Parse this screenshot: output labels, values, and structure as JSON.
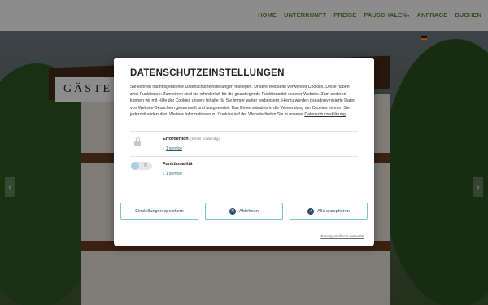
{
  "nav": {
    "items": [
      "HOME",
      "UNTERKUNFT",
      "PREISE",
      "PAUSCHALEN",
      "ANFRAGE",
      "BUCHEN"
    ],
    "dropdown_caret": "▾"
  },
  "hero": {
    "sign_text": "GÄSTE"
  },
  "modal": {
    "title": "DATENSCHUTZEINSTELLUNGEN",
    "description": "Sie können nachfolgend Ihre Datenschutzeinstellungen festlegen. Unsere Webseite verwendet Cookies. Diese haben zwei Funktionen: Zum einen sind sie erforderlich für die grundlegende Funktionalität unserer Website. Zum anderen können wir mit Hilfe der Cookies unsere Inhalte für Sie immer weiter verbessern. Hierzu werden pseudonymisierte Daten von Website-Besuchern gesammelt und ausgewertet. Das Einverständnis in die Verwendung der Cookies können Sie jederzeit widerrufen. Weitere Informationen zu Cookies auf der Website finden Sie in unserer ",
    "privacy_link": "Datenschutzerklärung",
    "options": [
      {
        "title": "Erforderlich",
        "note": "(immer notwendig)",
        "service": "1 service"
      },
      {
        "title": "Funktionalität",
        "note": "",
        "service": "1 service"
      }
    ],
    "service_prefix": "↓ ",
    "buttons": {
      "save": "Einstellungen speichern",
      "decline": "Ablehnen",
      "accept": "Alle akzeptieren"
    },
    "powered_by": "Bereitgestellt von webexBK"
  },
  "colors": {
    "nav_text": "#5e8a3e",
    "button_border": "#7fc3c9",
    "button_icon_bg": "#334a66",
    "toggle_knob": "#a9cfe2"
  },
  "icons": {
    "lock": "lock-icon",
    "decline": "close-icon",
    "accept": "check-icon",
    "language_flag": "german-flag-icon"
  }
}
